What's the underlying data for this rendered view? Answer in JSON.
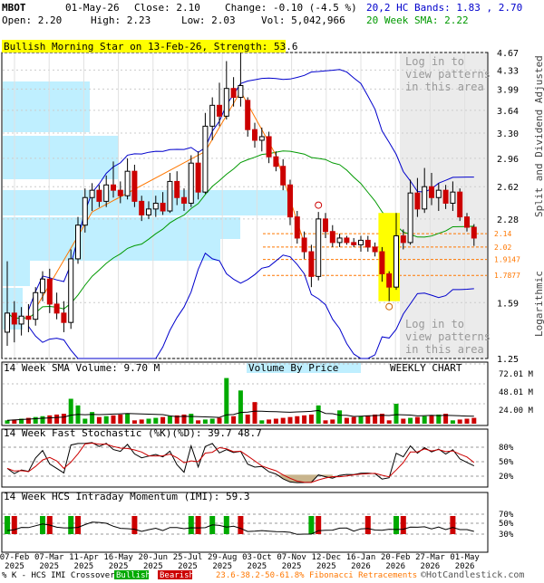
{
  "header": {
    "symbol": "MBOT",
    "date": "01-May-26",
    "close_label": "Close: 2.10",
    "change_label": "Change: -0.10 (-4.5 %)",
    "open_label": "Open: 2.20",
    "high_label": "High: 2.23",
    "low_label": "Low: 2.03",
    "vol_label": "Vol: 5,042,966",
    "bands_label": "20,2 HC Bands: 1.83 , 2.70",
    "sma_label": "20 Week SMA: 2.22"
  },
  "pattern_banner": "Bullish Morning Star on 13-Feb-26, Strength: 53.6",
  "login_notice": [
    "Log in to",
    "view patterns",
    "in this area"
  ],
  "price_panel": {
    "y_ticks": [
      "4.67",
      "4.33",
      "3.99",
      "3.64",
      "3.30",
      "2.96",
      "2.62",
      "2.28",
      "1.59",
      "1.25"
    ],
    "right_label_top": "Split and Dividend Adjusted",
    "right_label_bottom": "Logarithmic",
    "fib_levels": [
      "2.14",
      "2.02",
      "1.9147",
      "1.7877"
    ]
  },
  "volume_panel": {
    "label": "14 Week SMA Volume: 9.70 M",
    "vbp_label": "Volume By Price",
    "chart_type_label": "WEEKLY CHART",
    "y_ticks": [
      "72.01 M",
      "48.01 M",
      "24.00 M"
    ]
  },
  "stoch_panel": {
    "label": "14 Week Fast Stochastic (%K)(%D): 39.7 48.7",
    "y_ticks": [
      "80%",
      "50%",
      "20%"
    ]
  },
  "imi_panel": {
    "label": "14 Week HCS Intraday Momentum (IMI): 59.3",
    "y_ticks": [
      "70%",
      "50%",
      "30%"
    ]
  },
  "x_axis": [
    {
      "d": "07-Feb",
      "y": "2025"
    },
    {
      "d": "07-Mar",
      "y": "2025"
    },
    {
      "d": "11-Apr",
      "y": "2025"
    },
    {
      "d": "16-May",
      "y": "2025"
    },
    {
      "d": "20-Jun",
      "y": "2025"
    },
    {
      "d": "25-Jul",
      "y": "2025"
    },
    {
      "d": "29-Aug",
      "y": "2025"
    },
    {
      "d": "03-Oct",
      "y": "2025"
    },
    {
      "d": "07-Nov",
      "y": "2025"
    },
    {
      "d": "12-Dec",
      "y": "2025"
    },
    {
      "d": "16-Jan",
      "y": "2026"
    },
    {
      "d": "20-Feb",
      "y": "2026"
    },
    {
      "d": "27-Mar",
      "y": "2026"
    },
    {
      "d": "01-May",
      "y": "2026"
    }
  ],
  "footer": {
    "legend_prefix": "% K - HCS IMI Crossover,",
    "bullish": "Bullish",
    "bearish": "Bearish",
    "fib_note": "23.6-38.2-50-61.8% Fibonacci Retracements",
    "copyright": "©HotCandlestick.com"
  },
  "colors": {
    "up": "#00aa00",
    "down": "#cc0000",
    "bands": "#0000cc",
    "sma": "#009900",
    "vbp": "#bfefff",
    "highlight": "#ffff00",
    "fib": "#ff7700",
    "bg": "#ffffff"
  },
  "chart_data": {
    "type": "candlestick",
    "scale": "log",
    "ylim": [
      1.25,
      4.67
    ],
    "weeks": [
      {
        "o": 1.4,
        "h": 1.9,
        "l": 1.32,
        "c": 1.52
      },
      {
        "o": 1.52,
        "h": 1.6,
        "l": 1.34,
        "c": 1.45
      },
      {
        "o": 1.45,
        "h": 1.56,
        "l": 1.38,
        "c": 1.5
      },
      {
        "o": 1.5,
        "h": 1.58,
        "l": 1.4,
        "c": 1.48
      },
      {
        "o": 1.48,
        "h": 1.7,
        "l": 1.44,
        "c": 1.66
      },
      {
        "o": 1.66,
        "h": 1.82,
        "l": 1.6,
        "c": 1.76
      },
      {
        "o": 1.76,
        "h": 1.84,
        "l": 1.52,
        "c": 1.58
      },
      {
        "o": 1.58,
        "h": 1.66,
        "l": 1.48,
        "c": 1.52
      },
      {
        "o": 1.52,
        "h": 1.6,
        "l": 1.4,
        "c": 1.46
      },
      {
        "o": 1.46,
        "h": 2.0,
        "l": 1.42,
        "c": 1.92
      },
      {
        "o": 1.92,
        "h": 2.3,
        "l": 1.88,
        "c": 2.22
      },
      {
        "o": 2.22,
        "h": 2.6,
        "l": 2.15,
        "c": 2.5
      },
      {
        "o": 2.5,
        "h": 2.66,
        "l": 2.36,
        "c": 2.58
      },
      {
        "o": 2.58,
        "h": 2.64,
        "l": 2.4,
        "c": 2.46
      },
      {
        "o": 2.46,
        "h": 2.75,
        "l": 2.4,
        "c": 2.64
      },
      {
        "o": 2.64,
        "h": 2.92,
        "l": 2.5,
        "c": 2.58
      },
      {
        "o": 2.58,
        "h": 2.68,
        "l": 2.44,
        "c": 2.52
      },
      {
        "o": 2.52,
        "h": 2.96,
        "l": 2.48,
        "c": 2.8
      },
      {
        "o": 2.8,
        "h": 2.88,
        "l": 2.4,
        "c": 2.46
      },
      {
        "o": 2.46,
        "h": 2.52,
        "l": 2.26,
        "c": 2.32
      },
      {
        "o": 2.32,
        "h": 2.46,
        "l": 2.28,
        "c": 2.38
      },
      {
        "o": 2.38,
        "h": 2.52,
        "l": 2.3,
        "c": 2.44
      },
      {
        "o": 2.44,
        "h": 2.56,
        "l": 2.32,
        "c": 2.36
      },
      {
        "o": 2.36,
        "h": 2.78,
        "l": 2.34,
        "c": 2.68
      },
      {
        "o": 2.68,
        "h": 2.8,
        "l": 2.42,
        "c": 2.5
      },
      {
        "o": 2.5,
        "h": 2.6,
        "l": 2.36,
        "c": 2.44
      },
      {
        "o": 2.44,
        "h": 3.0,
        "l": 2.4,
        "c": 2.9
      },
      {
        "o": 2.9,
        "h": 3.05,
        "l": 2.48,
        "c": 2.56
      },
      {
        "o": 2.56,
        "h": 3.6,
        "l": 2.54,
        "c": 3.4
      },
      {
        "o": 3.4,
        "h": 3.85,
        "l": 3.2,
        "c": 3.72
      },
      {
        "o": 3.72,
        "h": 4.1,
        "l": 3.4,
        "c": 3.55
      },
      {
        "o": 3.55,
        "h": 4.5,
        "l": 3.5,
        "c": 4.0
      },
      {
        "o": 4.0,
        "h": 4.2,
        "l": 3.7,
        "c": 3.85
      },
      {
        "o": 3.85,
        "h": 4.67,
        "l": 3.7,
        "c": 4.05
      },
      {
        "o": 3.8,
        "h": 3.85,
        "l": 3.25,
        "c": 3.35
      },
      {
        "o": 3.35,
        "h": 3.45,
        "l": 3.1,
        "c": 3.2
      },
      {
        "o": 3.2,
        "h": 3.38,
        "l": 3.05,
        "c": 3.25
      },
      {
        "o": 3.25,
        "h": 3.32,
        "l": 2.9,
        "c": 2.98
      },
      {
        "o": 2.98,
        "h": 3.05,
        "l": 2.8,
        "c": 2.86
      },
      {
        "o": 2.86,
        "h": 2.95,
        "l": 2.58,
        "c": 2.64
      },
      {
        "o": 2.64,
        "h": 2.7,
        "l": 2.22,
        "c": 2.3
      },
      {
        "o": 2.3,
        "h": 2.36,
        "l": 2.05,
        "c": 2.1
      },
      {
        "o": 2.1,
        "h": 2.16,
        "l": 1.92,
        "c": 1.98
      },
      {
        "o": 1.98,
        "h": 2.04,
        "l": 1.7,
        "c": 1.78
      },
      {
        "o": 1.78,
        "h": 2.35,
        "l": 1.75,
        "c": 2.28
      },
      {
        "o": 2.28,
        "h": 2.34,
        "l": 2.1,
        "c": 2.16
      },
      {
        "o": 2.16,
        "h": 2.22,
        "l": 2.02,
        "c": 2.06
      },
      {
        "o": 2.06,
        "h": 2.14,
        "l": 2.02,
        "c": 2.1
      },
      {
        "o": 2.1,
        "h": 2.12,
        "l": 2.04,
        "c": 2.06
      },
      {
        "o": 2.06,
        "h": 2.1,
        "l": 2.02,
        "c": 2.04
      },
      {
        "o": 2.04,
        "h": 2.12,
        "l": 1.98,
        "c": 2.08
      },
      {
        "o": 2.08,
        "h": 2.12,
        "l": 1.98,
        "c": 2.02
      },
      {
        "o": 2.02,
        "h": 2.06,
        "l": 1.94,
        "c": 1.98
      },
      {
        "o": 1.98,
        "h": 2.02,
        "l": 1.74,
        "c": 1.8
      },
      {
        "o": 1.8,
        "h": 1.82,
        "l": 1.6,
        "c": 1.7
      },
      {
        "o": 1.7,
        "h": 2.34,
        "l": 1.68,
        "c": 2.12
      },
      {
        "o": 2.12,
        "h": 2.18,
        "l": 2.0,
        "c": 2.06
      },
      {
        "o": 2.06,
        "h": 2.7,
        "l": 2.04,
        "c": 2.55
      },
      {
        "o": 2.55,
        "h": 2.72,
        "l": 2.3,
        "c": 2.38
      },
      {
        "o": 2.38,
        "h": 2.84,
        "l": 2.34,
        "c": 2.62
      },
      {
        "o": 2.62,
        "h": 2.78,
        "l": 2.42,
        "c": 2.5
      },
      {
        "o": 2.5,
        "h": 2.66,
        "l": 2.36,
        "c": 2.58
      },
      {
        "o": 2.58,
        "h": 2.64,
        "l": 2.38,
        "c": 2.44
      },
      {
        "o": 2.44,
        "h": 2.68,
        "l": 2.36,
        "c": 2.56
      },
      {
        "o": 2.56,
        "h": 2.6,
        "l": 2.26,
        "c": 2.3
      },
      {
        "o": 2.3,
        "h": 2.34,
        "l": 2.16,
        "c": 2.2
      },
      {
        "o": 2.2,
        "h": 2.23,
        "l": 2.03,
        "c": 2.1
      }
    ]
  }
}
